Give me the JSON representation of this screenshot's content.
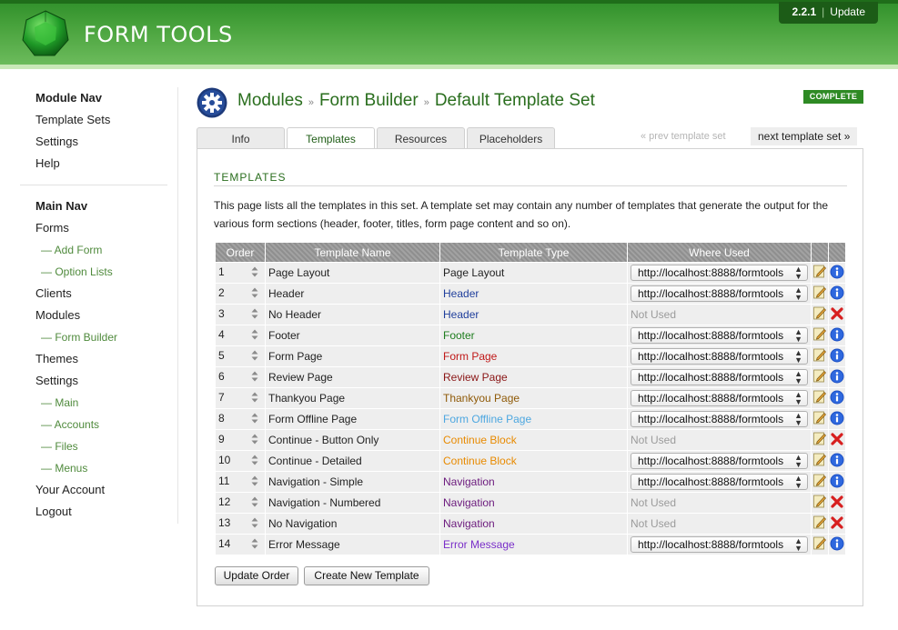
{
  "header": {
    "app_title": "FORM TOOLS",
    "version": "2.2.1",
    "update_label": "Update"
  },
  "sidebar": {
    "module_nav_heading": "Module Nav",
    "module_items": [
      "Template Sets",
      "Settings",
      "Help"
    ],
    "main_nav_heading": "Main Nav",
    "main_items": [
      {
        "label": "Forms",
        "sub": false
      },
      {
        "label": "— Add Form",
        "sub": true
      },
      {
        "label": "— Option Lists",
        "sub": true
      },
      {
        "label": "Clients",
        "sub": false
      },
      {
        "label": "Modules",
        "sub": false
      },
      {
        "label": "— Form Builder",
        "sub": true
      },
      {
        "label": "Themes",
        "sub": false
      },
      {
        "label": "Settings",
        "sub": false
      },
      {
        "label": "— Main",
        "sub": true
      },
      {
        "label": "— Accounts",
        "sub": true
      },
      {
        "label": "— Files",
        "sub": true
      },
      {
        "label": "— Menus",
        "sub": true
      },
      {
        "label": "Your Account",
        "sub": false
      },
      {
        "label": "Logout",
        "sub": false
      }
    ]
  },
  "breadcrumb": {
    "crumb1": "Modules",
    "crumb2": "Form Builder",
    "crumb3": "Default Template Set",
    "separator": "»"
  },
  "status_badge": "COMPLETE",
  "tabs": [
    "Info",
    "Templates",
    "Resources",
    "Placeholders"
  ],
  "active_tab": "Templates",
  "pager": {
    "prev": "« prev template set",
    "next": "next template set »"
  },
  "section": {
    "title": "TEMPLATES",
    "intro": "This page lists all the templates in this set. A template set may contain any number of templates that generate the output for the various form sections (header, footer, titles, form page content and so on)."
  },
  "table": {
    "headers": [
      "Order",
      "Template Name",
      "Template Type",
      "Where Used"
    ],
    "rows": [
      {
        "order": "1",
        "name": "Page Layout",
        "type": "Page Layout",
        "type_color": "#222222",
        "used": "http://localhost:8888/formtools",
        "in_use": true
      },
      {
        "order": "2",
        "name": "Header",
        "type": "Header",
        "type_color": "#1f3e9c",
        "used": "http://localhost:8888/formtools",
        "in_use": true
      },
      {
        "order": "3",
        "name": "No Header",
        "type": "Header",
        "type_color": "#1f3e9c",
        "used": "Not Used",
        "in_use": false
      },
      {
        "order": "4",
        "name": "Footer",
        "type": "Footer",
        "type_color": "#1e7d1e",
        "used": "http://localhost:8888/formtools",
        "in_use": true
      },
      {
        "order": "5",
        "name": "Form Page",
        "type": "Form Page",
        "type_color": "#c01818",
        "used": "http://localhost:8888/formtools",
        "in_use": true
      },
      {
        "order": "6",
        "name": "Review Page",
        "type": "Review Page",
        "type_color": "#8a1515",
        "used": "http://localhost:8888/formtools",
        "in_use": true
      },
      {
        "order": "7",
        "name": "Thankyou Page",
        "type": "Thankyou Page",
        "type_color": "#8f5a08",
        "used": "http://localhost:8888/formtools",
        "in_use": true
      },
      {
        "order": "8",
        "name": "Form Offline Page",
        "type": "Form Offline Page",
        "type_color": "#4da7e0",
        "used": "http://localhost:8888/formtools",
        "in_use": true
      },
      {
        "order": "9",
        "name": "Continue - Button Only",
        "type": "Continue Block",
        "type_color": "#e88a00",
        "used": "Not Used",
        "in_use": false
      },
      {
        "order": "10",
        "name": "Continue - Detailed",
        "type": "Continue Block",
        "type_color": "#e88a00",
        "used": "http://localhost:8888/formtools",
        "in_use": true
      },
      {
        "order": "11",
        "name": "Navigation - Simple",
        "type": "Navigation",
        "type_color": "#6b1a7d",
        "used": "http://localhost:8888/formtools",
        "in_use": true
      },
      {
        "order": "12",
        "name": "Navigation - Numbered",
        "type": "Navigation",
        "type_color": "#6b1a7d",
        "used": "Not Used",
        "in_use": false
      },
      {
        "order": "13",
        "name": "No Navigation",
        "type": "Navigation",
        "type_color": "#6b1a7d",
        "used": "Not Used",
        "in_use": false
      },
      {
        "order": "14",
        "name": "Error Message",
        "type": "Error Message",
        "type_color": "#7a2fc9",
        "used": "http://localhost:8888/formtools",
        "in_use": true
      }
    ]
  },
  "buttons": {
    "update_order": "Update Order",
    "create_new": "Create New Template"
  },
  "colors": {
    "brand_green": "#2a6e1e",
    "badge_green": "#2e8a24",
    "delete_red": "#d71f1f",
    "info_blue": "#1b4fc4"
  }
}
